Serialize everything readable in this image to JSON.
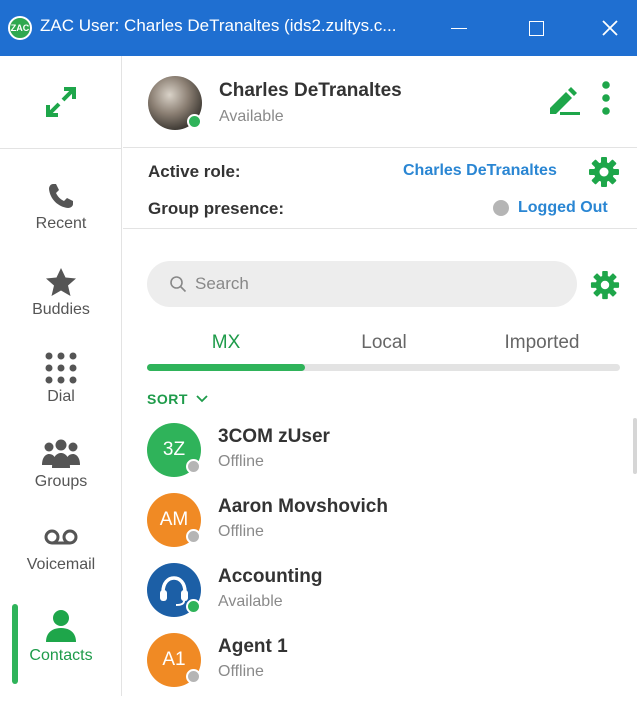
{
  "titlebar": {
    "title": "ZAC User: Charles DeTranaltes (ids2.zultys.c...",
    "logo_text": "ZAC",
    "minimize_glyph": "—",
    "maximize_glyph": "☐",
    "close_glyph": "✕"
  },
  "nav": [
    {
      "label": "Recent",
      "icon": "phone-icon"
    },
    {
      "label": "Buddies",
      "icon": "star-icon"
    },
    {
      "label": "Dial",
      "icon": "dialpad-icon"
    },
    {
      "label": "Groups",
      "icon": "groups-icon"
    },
    {
      "label": "Voicemail",
      "icon": "voicemail-icon"
    },
    {
      "label": "Contacts",
      "icon": "contact-icon",
      "active": true
    }
  ],
  "profile": {
    "name": "Charles DeTranaltes",
    "status": "Available"
  },
  "roles": {
    "active_role_label": "Active role:",
    "active_role_value": "Charles DeTranaltes",
    "group_presence_label": "Group presence:",
    "group_presence_value": "Logged Out"
  },
  "search": {
    "placeholder": "Search"
  },
  "tabs": [
    {
      "label": "MX",
      "active": true
    },
    {
      "label": "Local"
    },
    {
      "label": "Imported"
    }
  ],
  "sort_label": "SORT",
  "contacts": [
    {
      "initials": "3Z",
      "name": "3COM zUser",
      "status": "Offline",
      "color": "#2fb35a",
      "status_color": "#b5b5b5"
    },
    {
      "initials": "AM",
      "name": "Aaron Movshovich",
      "status": "Offline",
      "color": "#f08a24",
      "status_color": "#b5b5b5"
    },
    {
      "initials": "",
      "name": "Accounting",
      "status": "Available",
      "color": "#1c5fa6",
      "status_color": "#2fb35a"
    },
    {
      "initials": "A1",
      "name": "Agent 1",
      "status": "Offline",
      "color": "#f08a24",
      "status_color": "#b5b5b5"
    }
  ],
  "colors": {
    "accent": "#1e9b4a",
    "titlebar": "#1f6fd1",
    "link": "#2a86d3",
    "available": "#2fb35a",
    "offline": "#b5b5b5"
  }
}
